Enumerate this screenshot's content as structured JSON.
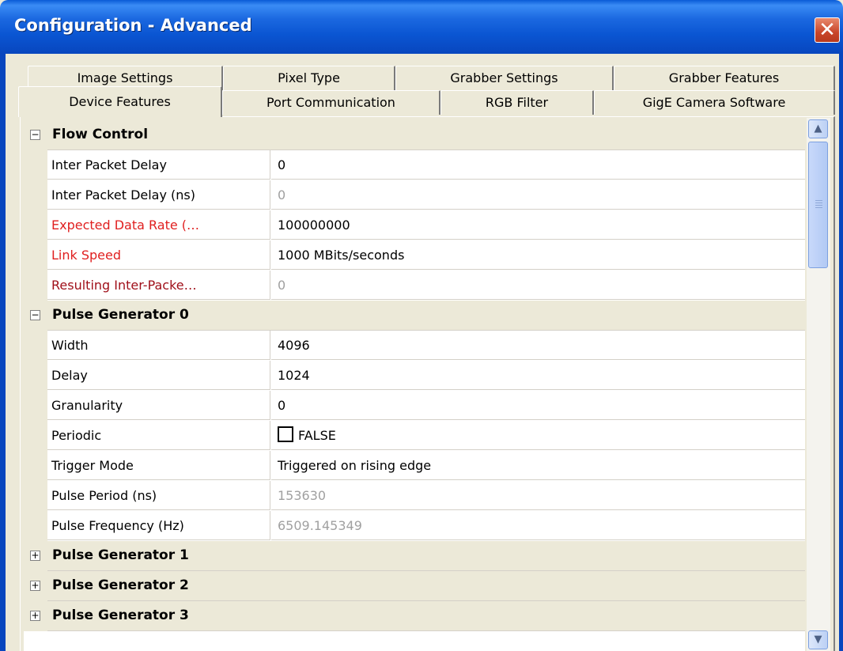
{
  "window": {
    "title": "Configuration - Advanced",
    "close_glyph": "✕"
  },
  "tabs": {
    "row1": [
      "Image Settings",
      "Pixel Type",
      "Grabber Settings",
      "Grabber Features"
    ],
    "row2": [
      "Device Features",
      "Port Communication",
      "RGB Filter",
      "GigE Camera Software"
    ],
    "active": "Device Features"
  },
  "grid": {
    "categories": {
      "flow_control": {
        "name": "Flow Control",
        "toggle": "−"
      },
      "pulse_generator_0": {
        "name": "Pulse Generator 0",
        "toggle": "−"
      },
      "pulse_generator_1": {
        "name": "Pulse Generator 1",
        "toggle": "+"
      },
      "pulse_generator_2": {
        "name": "Pulse Generator 2",
        "toggle": "+"
      },
      "pulse_generator_3": {
        "name": "Pulse Generator 3",
        "toggle": "+"
      }
    },
    "flow_control": [
      {
        "name": "Inter Packet Delay",
        "value": "0"
      },
      {
        "name": "Inter Packet Delay (ns)",
        "value": "0"
      },
      {
        "name": "Expected Data Rate (…",
        "value": "100000000"
      },
      {
        "name": "Link Speed",
        "value": "1000 MBits/seconds"
      },
      {
        "name": "Resulting Inter-Packe…",
        "value": "0"
      }
    ],
    "pulse_generator_0": [
      {
        "name": "Width",
        "value": "4096"
      },
      {
        "name": "Delay",
        "value": "1024"
      },
      {
        "name": "Granularity",
        "value": "0"
      },
      {
        "name": "Periodic",
        "value": "FALSE"
      },
      {
        "name": "Trigger Mode",
        "value": "Triggered on rising edge"
      },
      {
        "name": "Pulse Period (ns)",
        "value": "153630"
      },
      {
        "name": "Pulse Frequency (Hz)",
        "value": "6509.145349"
      }
    ]
  },
  "scrollbar": {
    "up_glyph": "▲",
    "down_glyph": "▼"
  },
  "colors": {
    "titlebar": "#0a55d2",
    "modified_name": "#e02020",
    "status_name": "#a0101a",
    "readonly_value": "#a0a0a0",
    "category_bg": "#ece9d8"
  }
}
